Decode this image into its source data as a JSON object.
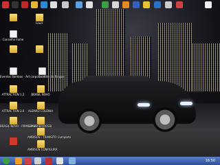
{
  "desktop": {
    "icons": [
      {
        "label": "",
        "kind": "folder"
      },
      {
        "label": "Loud",
        "kind": "folder"
      },
      {
        "label": "Conselho Fome",
        "kind": "doc"
      },
      {
        "label": "",
        "kind": "folder"
      },
      {
        "label": "",
        "kind": "folder"
      },
      {
        "label": "Eventos Sambas - Art corpo na Elite do Ringue",
        "kind": "doc"
      },
      {
        "label": "Excel",
        "kind": "doc"
      },
      {
        "label": "ATTRACTION 1.2",
        "kind": "folder"
      },
      {
        "label": "BRASIL NOVO",
        "kind": "folder"
      },
      {
        "label": "ATTRACTION 3.0",
        "kind": "folder"
      },
      {
        "label": "ALEMÃO COLÔNIA",
        "kind": "folder"
      },
      {
        "label": "BRASIL NOVO - PRIMEIROS",
        "kind": "folder"
      },
      {
        "label": "EMBRAER/ROSSI",
        "kind": "folder"
      },
      {
        "label": "AMBISOS - TRANSITO Completo",
        "kind": "folder"
      },
      {
        "label": "",
        "kind": "red"
      },
      {
        "label": "AMBISOS CONFIGURA",
        "kind": "folder"
      }
    ]
  },
  "top_icons": [
    {
      "name": "app-icon"
    },
    {
      "name": "app-icon"
    },
    {
      "name": "app-icon"
    },
    {
      "name": "app-icon"
    },
    {
      "name": "app-icon"
    },
    {
      "name": "app-icon"
    },
    {
      "name": "app-icon"
    },
    {
      "name": "app-icon"
    },
    {
      "name": "app-icon"
    },
    {
      "name": "app-icon"
    },
    {
      "name": "app-icon"
    },
    {
      "name": "app-icon"
    },
    {
      "name": "app-icon"
    },
    {
      "name": "app-icon"
    },
    {
      "name": "app-icon"
    },
    {
      "name": "app-icon"
    },
    {
      "name": "app-icon"
    },
    {
      "name": "app-icon"
    }
  ],
  "taskbar": {
    "clock": "16:50",
    "buttons": [
      {
        "name": "start-icon"
      },
      {
        "name": "ie-icon"
      },
      {
        "name": "opera-icon"
      },
      {
        "name": "media-icon"
      },
      {
        "name": "app-icon"
      },
      {
        "name": "app-icon"
      }
    ]
  },
  "colors": {
    "taskbar": "#3a62b0",
    "folder": "#e9c44f"
  }
}
